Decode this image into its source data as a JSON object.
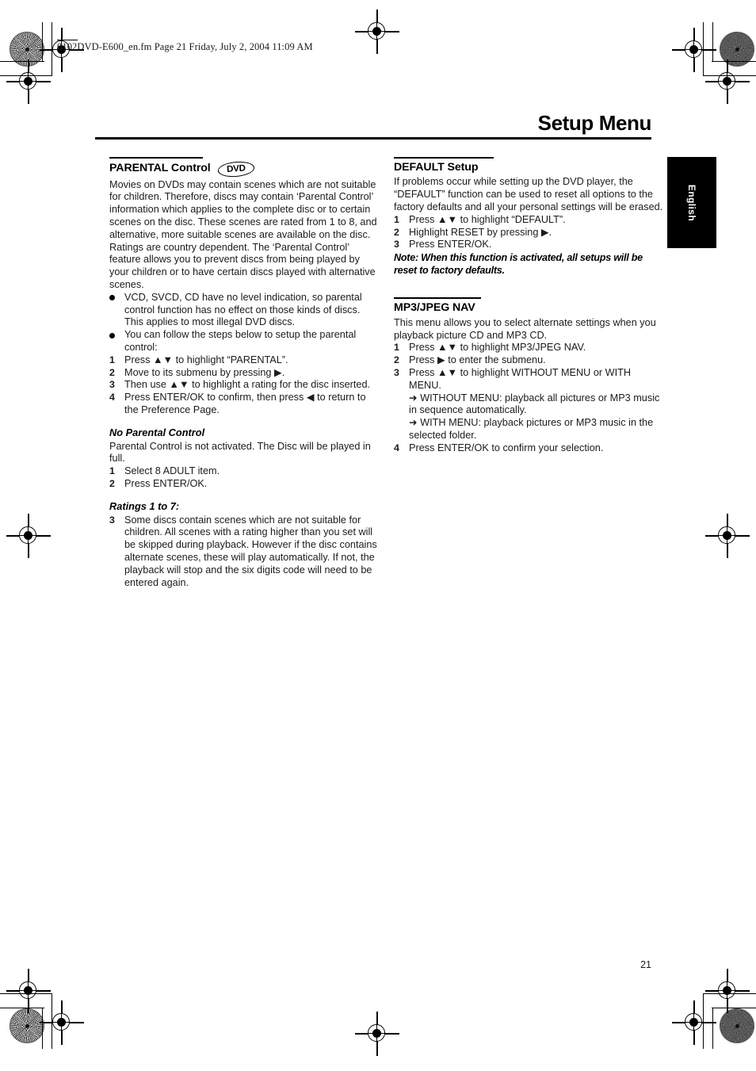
{
  "print_header": {
    "text": "0102DVD-E600_en.fm  Page 21  Friday, July 2, 2004  11:09 AM"
  },
  "page_title": "Setup Menu",
  "language_tab": "English",
  "page_number": "21",
  "colors": {
    "text": "#1b1b1b",
    "rule": "#000000",
    "tab_background": "#000000",
    "tab_text": "#ffffff"
  },
  "left_column": {
    "section_title": "PARENTAL Control",
    "badge_label": "DVD",
    "intro": "Movies on DVDs may contain scenes which are not suitable for children. Therefore, discs may contain ‘Parental Control’ information which applies to the complete disc or to certain scenes on the disc. These scenes are rated from 1 to 8, and alternative, more suitable scenes are available on the disc. Ratings are country dependent. The ‘Parental Control’ feature allows you to prevent discs from being played by your children or to have certain discs played with alternative scenes.",
    "bullets": [
      "VCD, SVCD, CD have no level indication, so parental control function has no effect on those kinds of discs. This applies to most illegal DVD discs.",
      "You can follow the steps below to setup the parental control:"
    ],
    "steps": [
      {
        "num": "1",
        "text": "Press ▲▼ to highlight “PARENTAL”."
      },
      {
        "num": "2",
        "text": "Move to its submenu by pressing ▶."
      },
      {
        "num": "3",
        "text": "Then use ▲▼ to highlight a rating for the disc inserted."
      },
      {
        "num": "4",
        "text": "Press ENTER/OK to confirm, then press ◀ to return to the Preference Page."
      }
    ],
    "subsection_no_parental": {
      "title": "No Parental Control",
      "body": "Parental Control is not activated. The Disc will be played in full.",
      "steps": [
        {
          "num": "1",
          "text": "Select 8 ADULT item."
        },
        {
          "num": "2",
          "text": "Press ENTER/OK."
        }
      ]
    },
    "subsection_ratings": {
      "title": "Ratings 1 to 7:",
      "steps": [
        {
          "num": "3",
          "text": "Some discs contain scenes which are not suitable for children. All scenes with a rating higher than you set will be skipped during playback. However if the disc contains alternate scenes, these will play automatically. If not, the playback will stop and the six digits code will need to be entered again."
        }
      ]
    }
  },
  "right_column": {
    "default_setup": {
      "section_title": "DEFAULT Setup",
      "intro": "If problems occur while setting up the DVD player, the “DEFAULT” function can be used to reset all options to the factory defaults and all your personal settings will be erased.",
      "steps": [
        {
          "num": "1",
          "text": "Press ▲▼ to highlight “DEFAULT”."
        },
        {
          "num": "2",
          "text": "Highlight RESET by pressing ▶."
        },
        {
          "num": "3",
          "text": "Press ENTER/OK."
        }
      ],
      "note": "Note: When this function is activated, all setups will be reset to factory defaults."
    },
    "mp3_jpeg_nav": {
      "section_title": "MP3/JPEG NAV",
      "intro": "This menu allows you to select alternate settings when you playback picture CD and MP3 CD.",
      "steps": [
        {
          "num": "1",
          "text": "Press ▲▼ to highlight MP3/JPEG NAV."
        },
        {
          "num": "2",
          "text": "Press ▶ to enter the submenu."
        },
        {
          "num": "3",
          "text": "Press ▲▼ to highlight WITHOUT MENU or WITH MENU."
        }
      ],
      "substeps": [
        "➜ WITHOUT MENU: playback all pictures or MP3 music in sequence automatically.",
        "➜ WITH MENU: playback pictures or MP3 music in the selected folder."
      ],
      "final_step": {
        "num": "4",
        "text": "Press ENTER/OK to confirm your selection."
      }
    }
  }
}
